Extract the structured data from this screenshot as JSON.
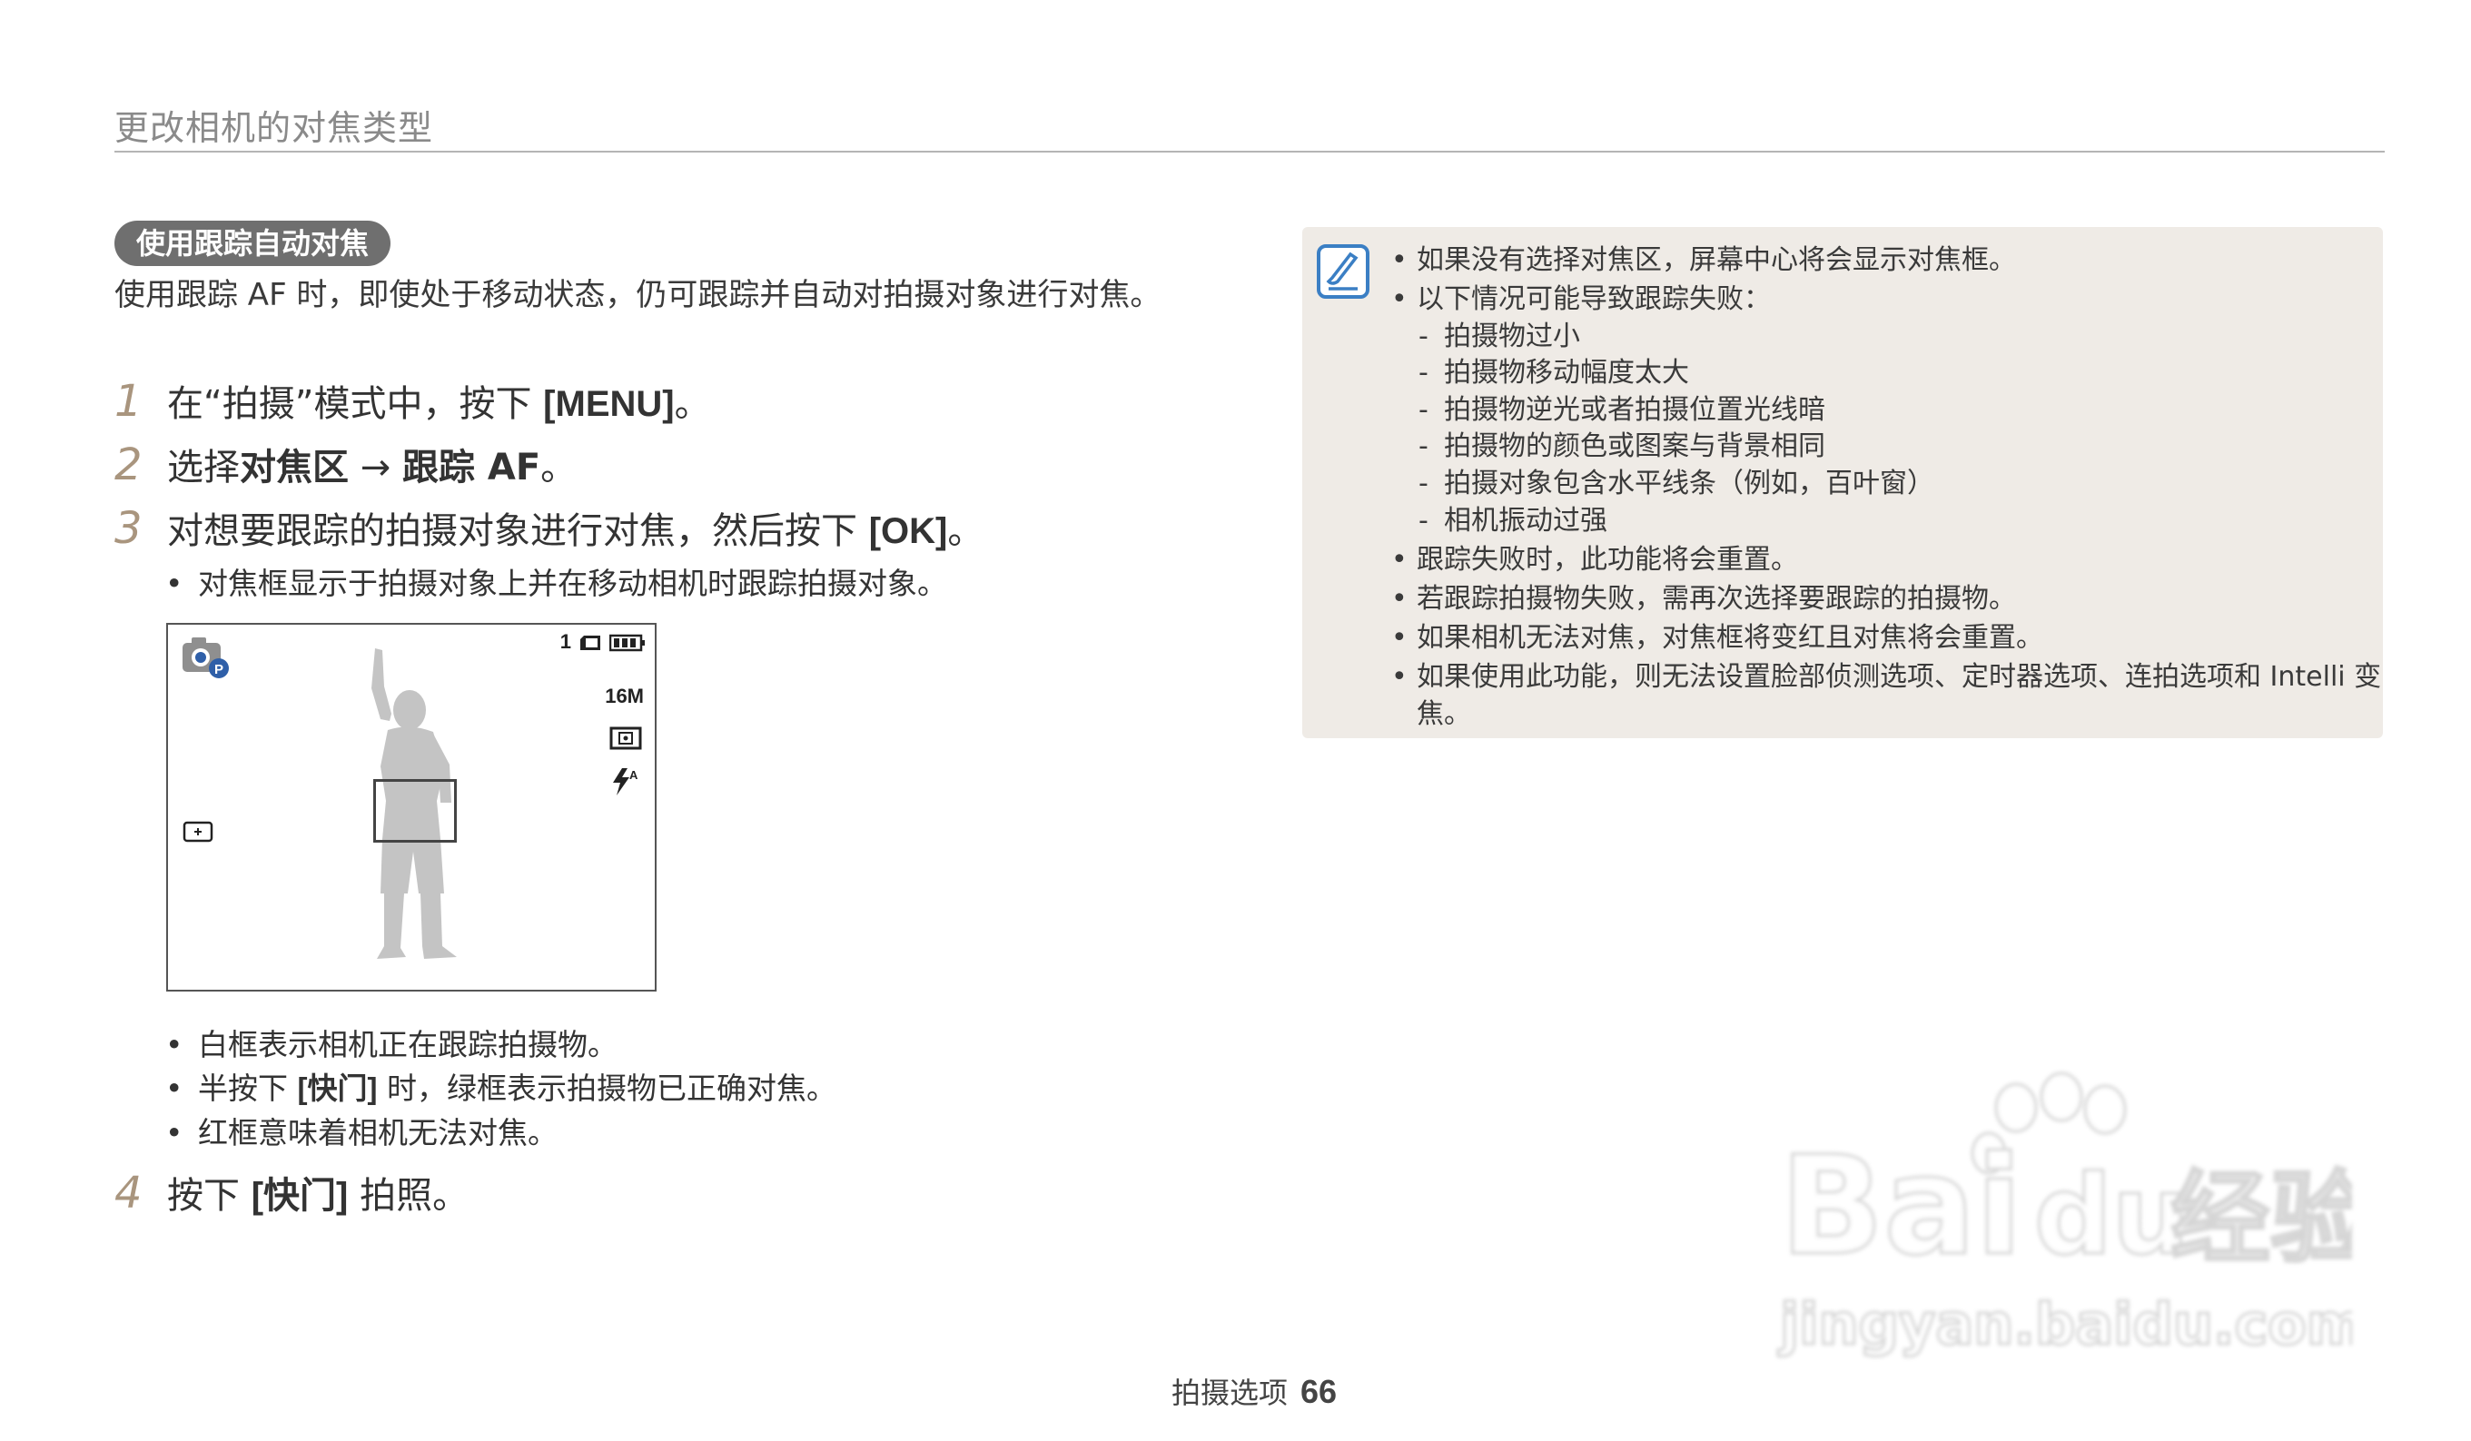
{
  "header": {
    "title": "更改相机的对焦类型"
  },
  "section": {
    "pill_label": "使用跟踪自动对焦"
  },
  "intro": {
    "text": "使用跟踪 AF 时，即使处于移动状态，仍可跟踪并自动对拍摄对象进行对焦。"
  },
  "steps": [
    {
      "num": "1",
      "pre": "在“拍摄”模式中，按下 ",
      "key": "[MENU]",
      "post": "。"
    },
    {
      "num": "2",
      "pre": "选择",
      "bold1": "对焦区",
      "arrow": " → ",
      "bold2": "跟踪 AF",
      "post": "。"
    },
    {
      "num": "3",
      "pre": "对想要跟踪的拍摄对象进行对焦，然后按下 ",
      "key": "[OK]",
      "post": "。"
    },
    {
      "num": "4",
      "pre": "按下 ",
      "key": "[快门]",
      "post": " 拍照。"
    }
  ],
  "step3_bullet": "对焦框显示于拍摄对象上并在移动相机时跟踪拍摄对象。",
  "viewfinder": {
    "shot_count": "1",
    "resolution": "16M",
    "icons": [
      "camera-mode-icon",
      "card-icon",
      "battery-icon",
      "metering-icon",
      "flash-auto-icon",
      "af-tracking-icon"
    ]
  },
  "frame_bullets": [
    {
      "text": "白框表示相机正在跟踪拍摄物。"
    },
    {
      "pre": "半按下 ",
      "key": "[快门]",
      "post": " 时，绿框表示拍摄物已正确对焦。"
    },
    {
      "text": "红框意味着相机无法对焦。"
    }
  ],
  "note": {
    "bullet1": "如果没有选择对焦区，屏幕中心将会显示对焦框。",
    "bullet2": "以下情况可能导致跟踪失败：",
    "dashes": [
      "拍摄物过小",
      "拍摄物移动幅度太大",
      "拍摄物逆光或者拍摄位置光线暗",
      "拍摄物的颜色或图案与背景相同",
      "拍摄对象包含水平线条（例如，百叶窗）",
      "相机振动过强"
    ],
    "bullet3": "跟踪失败时，此功能将会重置。",
    "bullet4": "若跟踪拍摄物失败，需再次选择要跟踪的拍摄物。",
    "bullet5": "如果相机无法对焦，对焦框将变红且对焦将会重置。",
    "bullet6_line1": "如果使用此功能，则无法设置脸部侦测选项、定时器选项、连拍选项和 Intelli 变",
    "bullet6_line2": "焦。"
  },
  "footer": {
    "label": "拍摄选项",
    "page": "66"
  },
  "watermark": {
    "line1": "Bai",
    "line1b": "du",
    "line1c": "经验",
    "line2": "jingyan.baidu.com"
  },
  "colors": {
    "step_number": "#a9957e",
    "note_bg": "#efebe6",
    "pill_bg": "#6f6f6f",
    "note_icon": "#3b7fc4"
  }
}
